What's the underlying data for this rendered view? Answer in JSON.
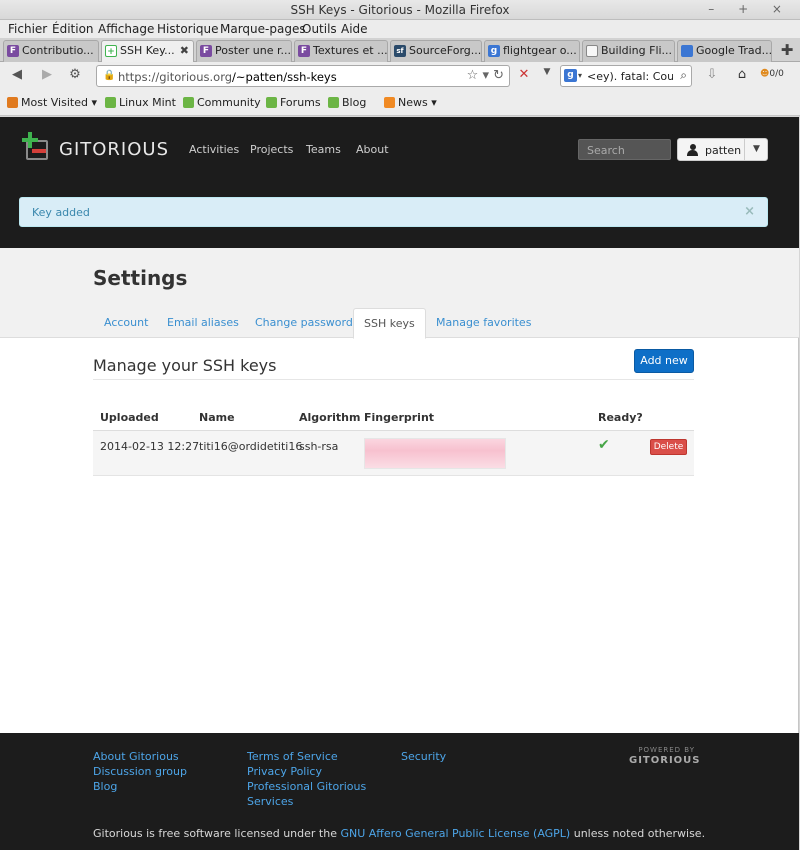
{
  "window": {
    "title": "SSH Keys - Gitorious - Mozilla Firefox",
    "controls": "– + ×"
  },
  "menu": [
    "Fichier",
    "Édition",
    "Affichage",
    "Historique",
    "Marque-pages",
    "Outils",
    "Aide"
  ],
  "tabs": [
    {
      "label": "Contributio...",
      "icon": "F",
      "color": "#7a4ba0"
    },
    {
      "label": "SSH Key...",
      "icon": "+",
      "color": "#3fb34f",
      "active": true
    },
    {
      "label": "Poster une r...",
      "icon": "F",
      "color": "#7a4ba0"
    },
    {
      "label": "Textures et ...",
      "icon": "F",
      "color": "#7a4ba0"
    },
    {
      "label": "SourceForg...",
      "icon": "sf",
      "color": "#2a4a6a"
    },
    {
      "label": "flightgear o...",
      "icon": "g",
      "color": "#3b76d3"
    },
    {
      "label": "Building Fli...",
      "icon": "",
      "color": "#f7f7f7"
    },
    {
      "label": "Google Trad...",
      "icon": "",
      "color": "#3b76d3"
    }
  ],
  "navbar": {
    "url_host": "https://gitorious.org",
    "url_path": "/~patten/ssh-keys",
    "search_text": "<ey). fatal: Could",
    "addon_badge": "0/0"
  },
  "bookmarks": [
    {
      "label": "Most Visited ▾",
      "color": "#e07a1f"
    },
    {
      "label": "Linux Mint",
      "color": "#6cb545"
    },
    {
      "label": "Community",
      "color": "#6cb545"
    },
    {
      "label": "Forums",
      "color": "#6cb545"
    },
    {
      "label": "Blog",
      "color": "#6cb545"
    },
    {
      "label": "News ▾",
      "color": "#f08a24"
    }
  ],
  "header": {
    "logo_text": "GITORIOUS",
    "nav": [
      "Activities",
      "Projects",
      "Teams",
      "About"
    ],
    "search_placeholder": "Search",
    "username": "patten"
  },
  "alert": {
    "message": "Key added",
    "close": "×"
  },
  "settings": {
    "title": "Settings",
    "tabs": [
      "Account",
      "Email aliases",
      "Change password",
      "SSH keys",
      "Manage favorites"
    ],
    "active_tab": "SSH keys"
  },
  "ssh_keys": {
    "heading": "Manage your SSH keys",
    "add_button": "Add new",
    "columns": [
      "Uploaded",
      "Name",
      "Algorithm",
      "Fingerprint",
      "Ready?"
    ],
    "rows": [
      {
        "uploaded": "2014-02-13 12:27",
        "name": "titi16@ordidetiti16",
        "algorithm": "ssh-rsa",
        "fingerprint": "",
        "ready": "✔",
        "delete": "Delete"
      }
    ]
  },
  "footer": {
    "col1": [
      "About Gitorious",
      "Discussion group",
      "Blog"
    ],
    "col2": [
      "Terms of Service",
      "Privacy Policy",
      "Professional Gitorious",
      "Services"
    ],
    "col3": [
      "Security"
    ],
    "powered_by": "POWERED BY",
    "powered_brand": "GITORIOUS",
    "license_pre": "Gitorious is free software licensed under the ",
    "license_link": "GNU Affero General Public License (AGPL)",
    "license_post": " unless noted otherwise."
  }
}
